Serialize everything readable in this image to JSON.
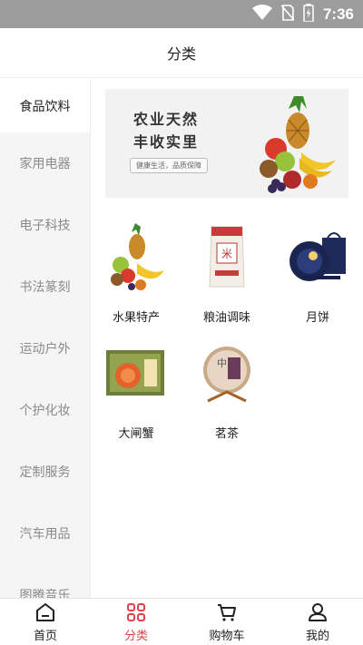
{
  "status_bar": {
    "time": "7:36",
    "icons": [
      "wifi-icon",
      "no-sim-icon",
      "battery-charging-icon"
    ]
  },
  "header": {
    "title": "分类"
  },
  "sidebar": {
    "items": [
      {
        "label": "食品饮料",
        "active": true
      },
      {
        "label": "家用电器"
      },
      {
        "label": "电子科技"
      },
      {
        "label": "书法篆刻"
      },
      {
        "label": "运动户外"
      },
      {
        "label": "个护化妆"
      },
      {
        "label": "定制服务"
      },
      {
        "label": "汽车用品"
      },
      {
        "label": "图腾音乐"
      }
    ]
  },
  "banner": {
    "line1": "农业天然",
    "line2": "丰收实里",
    "tag": "健康生活，品质保障"
  },
  "categories": [
    {
      "label": "水果特产",
      "icon": "fruit-basket-image"
    },
    {
      "label": "粮油调味",
      "icon": "rice-bag-image"
    },
    {
      "label": "月饼",
      "icon": "mooncake-box-image"
    },
    {
      "label": "大闸蟹",
      "icon": "crab-box-image"
    },
    {
      "label": "茗茶",
      "icon": "tea-cake-image"
    }
  ],
  "bottom_nav": {
    "items": [
      {
        "label": "首页",
        "icon": "home-icon"
      },
      {
        "label": "分类",
        "icon": "category-grid-icon",
        "active": true
      },
      {
        "label": "购物车",
        "icon": "cart-icon"
      },
      {
        "label": "我的",
        "icon": "user-icon"
      }
    ]
  },
  "colors": {
    "accent": "#e2424b",
    "sidebar_bg": "#f5f5f5",
    "status_bar": "#9c9c9c"
  }
}
